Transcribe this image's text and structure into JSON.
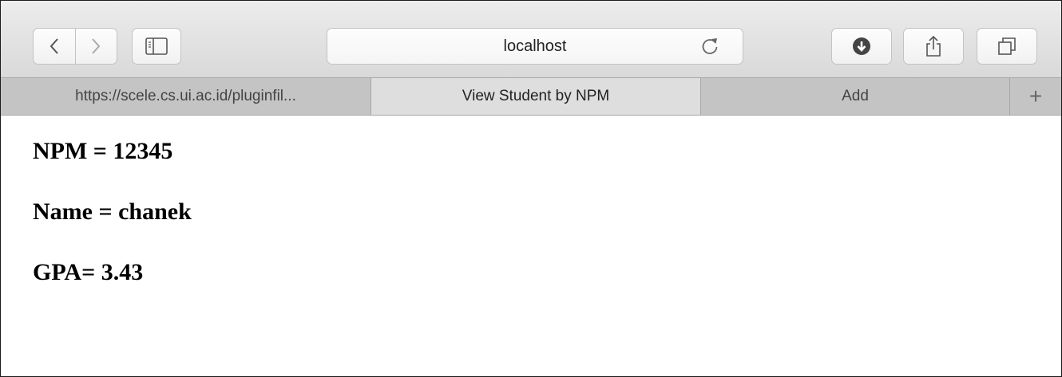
{
  "browser": {
    "address": "localhost",
    "icons": {
      "back": "chevron-left-icon",
      "forward": "chevron-right-icon",
      "sidebar": "sidebar-icon",
      "reload": "reload-icon",
      "downloads": "download-icon",
      "share": "share-icon",
      "tabs": "tabs-overview-icon",
      "new_tab": "plus-icon"
    }
  },
  "tabs": [
    {
      "label": "https://scele.cs.ui.ac.id/pluginfil..."
    },
    {
      "label": "View Student by NPM"
    },
    {
      "label": "Add"
    }
  ],
  "tab_add_label": "+",
  "student": {
    "npm": "NPM = 12345",
    "name": "Name = chanek",
    "gpa": "GPA= 3.43"
  }
}
